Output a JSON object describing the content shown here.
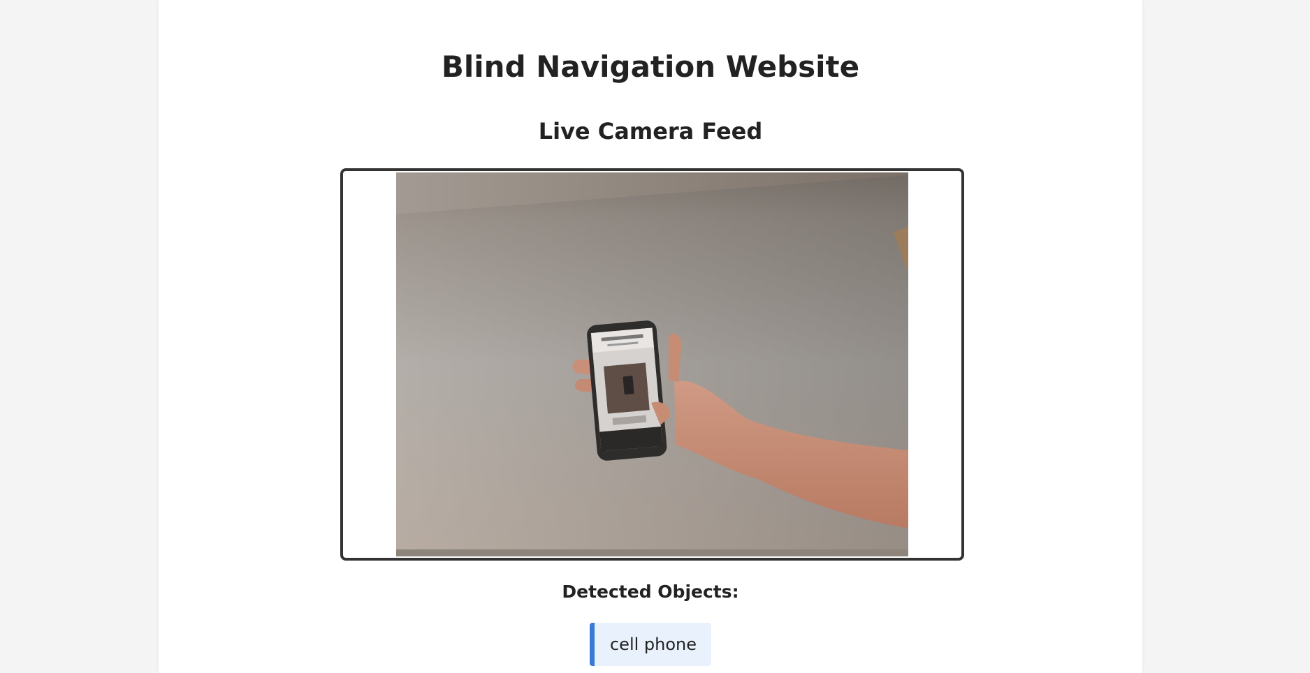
{
  "header": {
    "title": "Blind Navigation Website"
  },
  "camera": {
    "heading": "Live Camera Feed",
    "feed_icon": "camera-feed-image"
  },
  "detection": {
    "heading": "Detected Objects:",
    "items": [
      {
        "label": "cell phone"
      }
    ]
  },
  "colors": {
    "page_background": "#f4f4f4",
    "content_background": "#ffffff",
    "frame_border": "#333333",
    "badge_background": "#e9f1fd",
    "badge_accent": "#3b79d4"
  }
}
